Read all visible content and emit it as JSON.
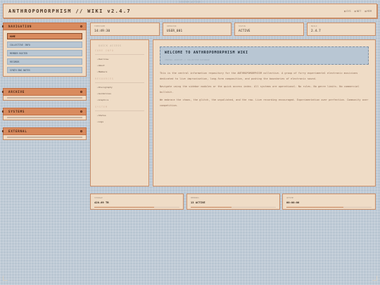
{
  "top_status": "· SYSTEM ACTIVE ·",
  "app": {
    "title": "ANTHROPOMORPHISM // WIKI v2.4.7",
    "stats": [
      "SYS",
      "NET",
      "MEM"
    ]
  },
  "sidebar": {
    "navigation": {
      "title": "NAVIGATION",
      "items": [
        {
          "label": "HOME",
          "active": true
        },
        {
          "label": "COLLECTIVE INFO",
          "active": false
        },
        {
          "label": "MEMBER ROSTER",
          "active": false
        },
        {
          "label": "RECORDS",
          "active": false
        },
        {
          "label": "SYNTH ENG NOTES",
          "active": false
        }
      ]
    },
    "collapsed": [
      {
        "title": "ARCHIVE"
      },
      {
        "title": "SYSTEMS"
      },
      {
        "title": "EXTERNAL"
      }
    ]
  },
  "status_cards": [
    {
      "label": "TIMESTAMP",
      "value": "14:49:30"
    },
    {
      "label": "OPERATOR",
      "value": "USER_001"
    },
    {
      "label": "STATUS",
      "value": "ACTIVE"
    },
    {
      "label": "BUILD",
      "value": "2.4.7"
    }
  ],
  "quick_access": {
    "title": "QUICK ACCESS",
    "sections": [
      {
        "title": "CORE INFO",
        "links": [
          "Overview",
          "About",
          "Members"
        ]
      },
      {
        "title": "RESOURCES",
        "links": [
          "Discography",
          "Guidelines",
          "Graphics"
        ]
      },
      {
        "title": "SYSTEM",
        "links": [
          "Status",
          "Logs"
        ]
      }
    ]
  },
  "main": {
    "welcome_title": "WELCOME TO ANTHROPOMORPHISM WIKI",
    "welcome_sub": "CENTRAL ARCHIVE // COLLECTIVE DATABASE",
    "paragraphs": [
      "This is the central information repository for the ANTHROPOMORPHISM collective. A group of furry experimental electronic musicians dedicated to live improvisation, long-form composition, and pushing the boundaries of electronic sound.",
      "Navigate using the sidebar modules or the quick access index. All systems are operational. No rules. No genre limits. No commercial bullshit.",
      "We embrace the chaos, the glitch, the unpolished, and the raw. Live recording encouraged. Experimentation over perfection. Community over competition."
    ]
  },
  "bottom_cards": [
    {
      "label": "STORAGE",
      "value": "420.69 TB",
      "fill": 0.7
    },
    {
      "label": "MEMBERS",
      "value": "13 ACTIVE",
      "fill": 0.48
    },
    {
      "label": "UPTIME",
      "value": "00:00:00",
      "fill": 0.67
    }
  ],
  "colors": {
    "accent": "#d98b5e",
    "panel": "#efdcc6",
    "background": "#b9c6d2",
    "highlight": "#b8c6d3"
  }
}
